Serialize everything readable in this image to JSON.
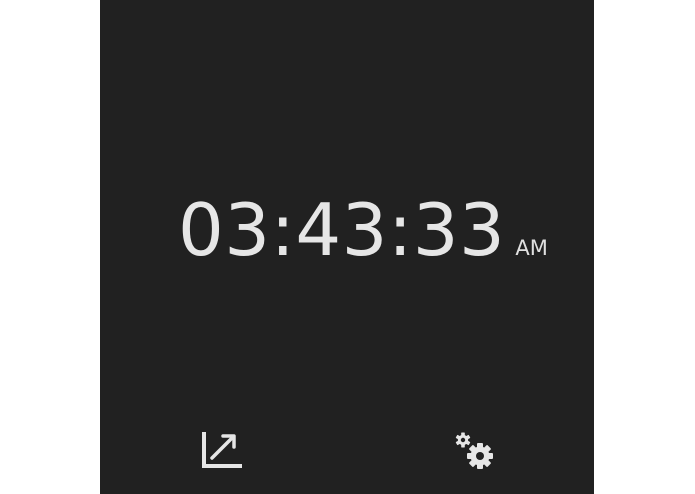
{
  "clock": {
    "time": "03:43:33",
    "ampm": "AM"
  },
  "toolbar": {
    "left_icon": "expand-diagonal-icon",
    "right_icon": "gear-icon"
  },
  "colors": {
    "background": "#212121",
    "text": "#e6e6e6",
    "page": "#ffffff"
  }
}
